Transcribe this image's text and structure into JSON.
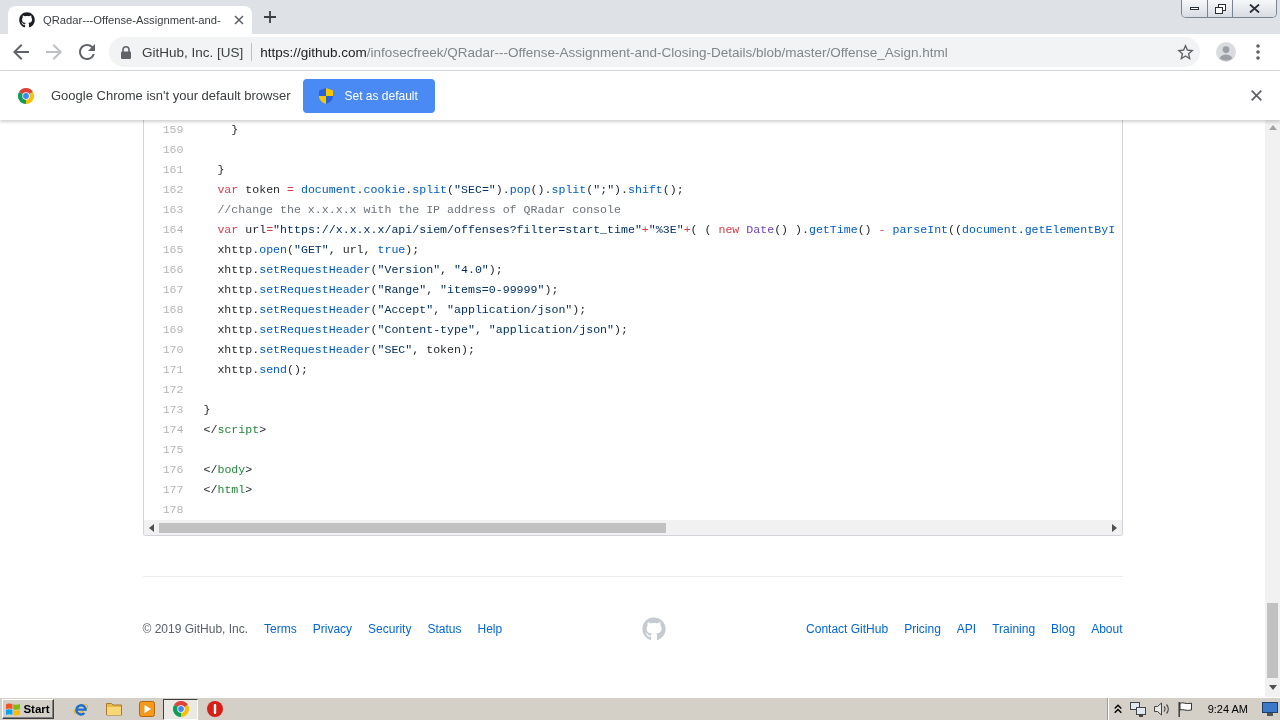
{
  "tabs": [
    {
      "title": "QRadar---Offense-Assignment-and-",
      "selected": true
    }
  ],
  "navigation": [
    {
      "kind": "back",
      "disabled": false
    },
    {
      "kind": "forward",
      "disabled": true
    },
    {
      "kind": "reload",
      "disabled": false
    }
  ],
  "address_bar": {
    "site_identity": "GitHub, Inc. [US]",
    "url_origin": "https://github.com",
    "url_path": "/infosecfreek/QRadar---Offense-Assignment-and-Closing-Details/blob/master/Offense_Asign.html"
  },
  "infobar": {
    "message": "Google Chrome isn't your default browser",
    "button": "Set as default"
  },
  "code": {
    "lines": [
      {
        "number": "159",
        "tokens": [
          {
            "kind": "plain",
            "text": "    }"
          }
        ]
      },
      {
        "number": "160"
      },
      {
        "number": "161",
        "tokens": [
          {
            "kind": "plain",
            "text": "  }"
          }
        ]
      },
      {
        "number": "162",
        "tokens": [
          {
            "kind": "keyword",
            "text": "  var"
          },
          {
            "kind": "plain",
            "text": " token "
          },
          {
            "kind": "operator",
            "text": "= "
          },
          {
            "kind": "constant",
            "text": "document"
          },
          {
            "kind": "plain",
            "text": "."
          },
          {
            "kind": "constant",
            "text": "cookie"
          },
          {
            "kind": "plain",
            "text": "."
          },
          {
            "kind": "constant",
            "text": "split"
          },
          {
            "kind": "plain",
            "text": "("
          },
          {
            "kind": "string",
            "text": "\"SEC=\""
          },
          {
            "kind": "plain",
            "text": ")."
          },
          {
            "kind": "constant",
            "text": "pop"
          },
          {
            "kind": "plain",
            "text": "()."
          },
          {
            "kind": "constant",
            "text": "split"
          },
          {
            "kind": "plain",
            "text": "("
          },
          {
            "kind": "string",
            "text": "\";\""
          },
          {
            "kind": "plain",
            "text": ")."
          },
          {
            "kind": "constant",
            "text": "shift"
          },
          {
            "kind": "plain",
            "text": "();"
          }
        ]
      },
      {
        "number": "163",
        "tokens": [
          {
            "kind": "comment",
            "text": "  //change the x.x.x.x with the IP address of QRadar console"
          }
        ]
      },
      {
        "number": "164",
        "tokens": [
          {
            "kind": "keyword",
            "text": "  var"
          },
          {
            "kind": "plain",
            "text": " url"
          },
          {
            "kind": "operator",
            "text": "="
          },
          {
            "kind": "string",
            "text": "\"https://x.x.x.x/api/siem/offenses?filter=start_time\""
          },
          {
            "kind": "operator",
            "text": "+"
          },
          {
            "kind": "string",
            "text": "\"%3E\""
          },
          {
            "kind": "operator",
            "text": "+"
          },
          {
            "kind": "plain",
            "text": "( ( "
          },
          {
            "kind": "keyword",
            "text": "new "
          },
          {
            "kind": "entity",
            "text": "Date"
          },
          {
            "kind": "plain",
            "text": "() )."
          },
          {
            "kind": "constant",
            "text": "getTime"
          },
          {
            "kind": "plain",
            "text": "() "
          },
          {
            "kind": "operator",
            "text": "- "
          },
          {
            "kind": "constant",
            "text": "parseInt"
          },
          {
            "kind": "plain",
            "text": "(("
          },
          {
            "kind": "constant",
            "text": "document"
          },
          {
            "kind": "plain",
            "text": "."
          },
          {
            "kind": "constant",
            "text": "getElementByI"
          }
        ]
      },
      {
        "number": "165",
        "tokens": [
          {
            "kind": "plain",
            "text": "  xhttp."
          },
          {
            "kind": "constant",
            "text": "open"
          },
          {
            "kind": "plain",
            "text": "("
          },
          {
            "kind": "string",
            "text": "\"GET\""
          },
          {
            "kind": "plain",
            "text": ", url, "
          },
          {
            "kind": "constant",
            "text": "true"
          },
          {
            "kind": "plain",
            "text": ");"
          }
        ]
      },
      {
        "number": "166",
        "tokens": [
          {
            "kind": "plain",
            "text": "  xhttp."
          },
          {
            "kind": "constant",
            "text": "setRequestHeader"
          },
          {
            "kind": "plain",
            "text": "("
          },
          {
            "kind": "string",
            "text": "\"Version\""
          },
          {
            "kind": "plain",
            "text": ", "
          },
          {
            "kind": "string",
            "text": "\"4.0\""
          },
          {
            "kind": "plain",
            "text": ");"
          }
        ]
      },
      {
        "number": "167",
        "tokens": [
          {
            "kind": "plain",
            "text": "  xhttp."
          },
          {
            "kind": "constant",
            "text": "setRequestHeader"
          },
          {
            "kind": "plain",
            "text": "("
          },
          {
            "kind": "string",
            "text": "\"Range\""
          },
          {
            "kind": "plain",
            "text": ", "
          },
          {
            "kind": "string",
            "text": "\"items=0-99999\""
          },
          {
            "kind": "plain",
            "text": ");"
          }
        ]
      },
      {
        "number": "168",
        "tokens": [
          {
            "kind": "plain",
            "text": "  xhttp."
          },
          {
            "kind": "constant",
            "text": "setRequestHeader"
          },
          {
            "kind": "plain",
            "text": "("
          },
          {
            "kind": "string",
            "text": "\"Accept\""
          },
          {
            "kind": "plain",
            "text": ", "
          },
          {
            "kind": "string",
            "text": "\"application/json\""
          },
          {
            "kind": "plain",
            "text": ");"
          }
        ]
      },
      {
        "number": "169",
        "tokens": [
          {
            "kind": "plain",
            "text": "  xhttp."
          },
          {
            "kind": "constant",
            "text": "setRequestHeader"
          },
          {
            "kind": "plain",
            "text": "("
          },
          {
            "kind": "string",
            "text": "\"Content-type\""
          },
          {
            "kind": "plain",
            "text": ", "
          },
          {
            "kind": "string",
            "text": "\"application/json\""
          },
          {
            "kind": "plain",
            "text": ");"
          }
        ]
      },
      {
        "number": "170",
        "tokens": [
          {
            "kind": "plain",
            "text": "  xhttp."
          },
          {
            "kind": "constant",
            "text": "setRequestHeader"
          },
          {
            "kind": "plain",
            "text": "("
          },
          {
            "kind": "string",
            "text": "\"SEC\""
          },
          {
            "kind": "plain",
            "text": ", token);"
          }
        ]
      },
      {
        "number": "171",
        "tokens": [
          {
            "kind": "plain",
            "text": "  xhttp."
          },
          {
            "kind": "constant",
            "text": "send"
          },
          {
            "kind": "plain",
            "text": "();"
          }
        ]
      },
      {
        "number": "172"
      },
      {
        "number": "173",
        "tokens": [
          {
            "kind": "plain",
            "text": "}"
          }
        ]
      },
      {
        "number": "174",
        "tokens": [
          {
            "kind": "plain",
            "text": "</"
          },
          {
            "kind": "tag",
            "text": "script"
          },
          {
            "kind": "plain",
            "text": ">"
          }
        ]
      },
      {
        "number": "175"
      },
      {
        "number": "176",
        "tokens": [
          {
            "kind": "plain",
            "text": "</"
          },
          {
            "kind": "tag",
            "text": "body"
          },
          {
            "kind": "plain",
            "text": ">"
          }
        ]
      },
      {
        "number": "177",
        "tokens": [
          {
            "kind": "plain",
            "text": "</"
          },
          {
            "kind": "tag",
            "text": "html"
          },
          {
            "kind": "plain",
            "text": ">"
          }
        ]
      },
      {
        "number": "178"
      }
    ]
  },
  "footer": {
    "copyright": "© 2019 GitHub, Inc.",
    "left_links": [
      "Terms",
      "Privacy",
      "Security",
      "Status",
      "Help"
    ],
    "right_links": [
      "Contact GitHub",
      "Pricing",
      "API",
      "Training",
      "Blog",
      "About"
    ]
  },
  "taskbar": {
    "start": "Start",
    "apps": [
      {
        "kind": "ie",
        "selected": false
      },
      {
        "kind": "folder",
        "selected": false
      },
      {
        "kind": "media",
        "selected": false
      },
      {
        "kind": "chrome",
        "selected": true
      },
      {
        "kind": "alert",
        "selected": false
      }
    ],
    "clock": "9:24 AM"
  }
}
